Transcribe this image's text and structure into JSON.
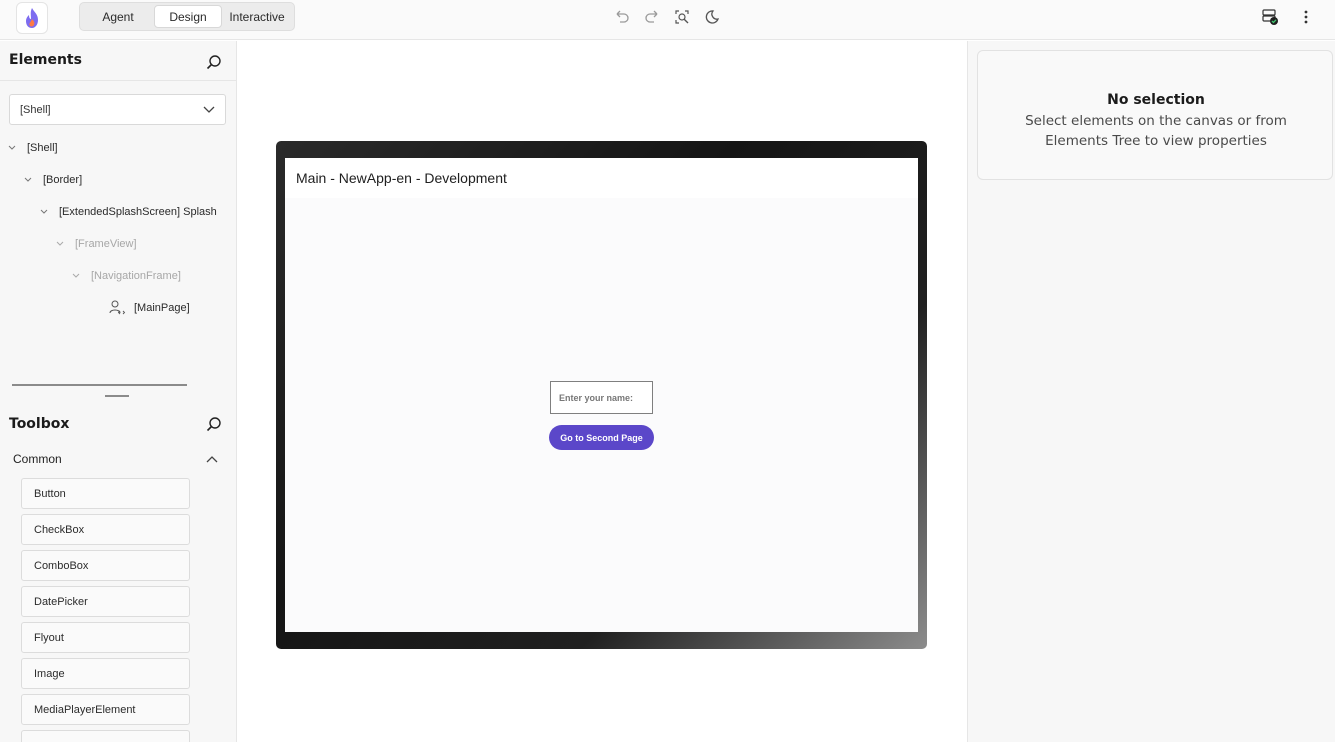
{
  "topbar": {
    "modes": [
      "Agent",
      "Design",
      "Interactive"
    ],
    "active_mode": "Design",
    "icons": [
      "undo-icon",
      "redo-icon",
      "inspect-icon",
      "theme-icon",
      "server-status-icon",
      "more-icon"
    ]
  },
  "elements_panel": {
    "title": "Elements",
    "selector_value": "[Shell]",
    "tree": [
      {
        "label": "[Shell]",
        "dim": false
      },
      {
        "label": "[Border]",
        "dim": false
      },
      {
        "label": "[ExtendedSplashScreen] Splash",
        "dim": false
      },
      {
        "label": "[FrameView]",
        "dim": true
      },
      {
        "label": "[NavigationFrame]",
        "dim": true
      },
      {
        "label": "[MainPage]",
        "dim": false
      }
    ]
  },
  "toolbox": {
    "title": "Toolbox",
    "category": "Common",
    "items": [
      "Button",
      "CheckBox",
      "ComboBox",
      "DatePicker",
      "Flyout",
      "Image",
      "MediaPlayerElement"
    ]
  },
  "canvas": {
    "window_title": "Main - NewApp-en - Development",
    "input_placeholder": "Enter your name:",
    "button_label": "Go to Second Page"
  },
  "properties": {
    "title": "No selection",
    "description": "Select elements on the canvas or from Elements Tree to view properties"
  },
  "colors": {
    "accent": "#5b47c9",
    "logo_gradient": [
      "#7d6cf0",
      "#ff6b3d"
    ]
  }
}
